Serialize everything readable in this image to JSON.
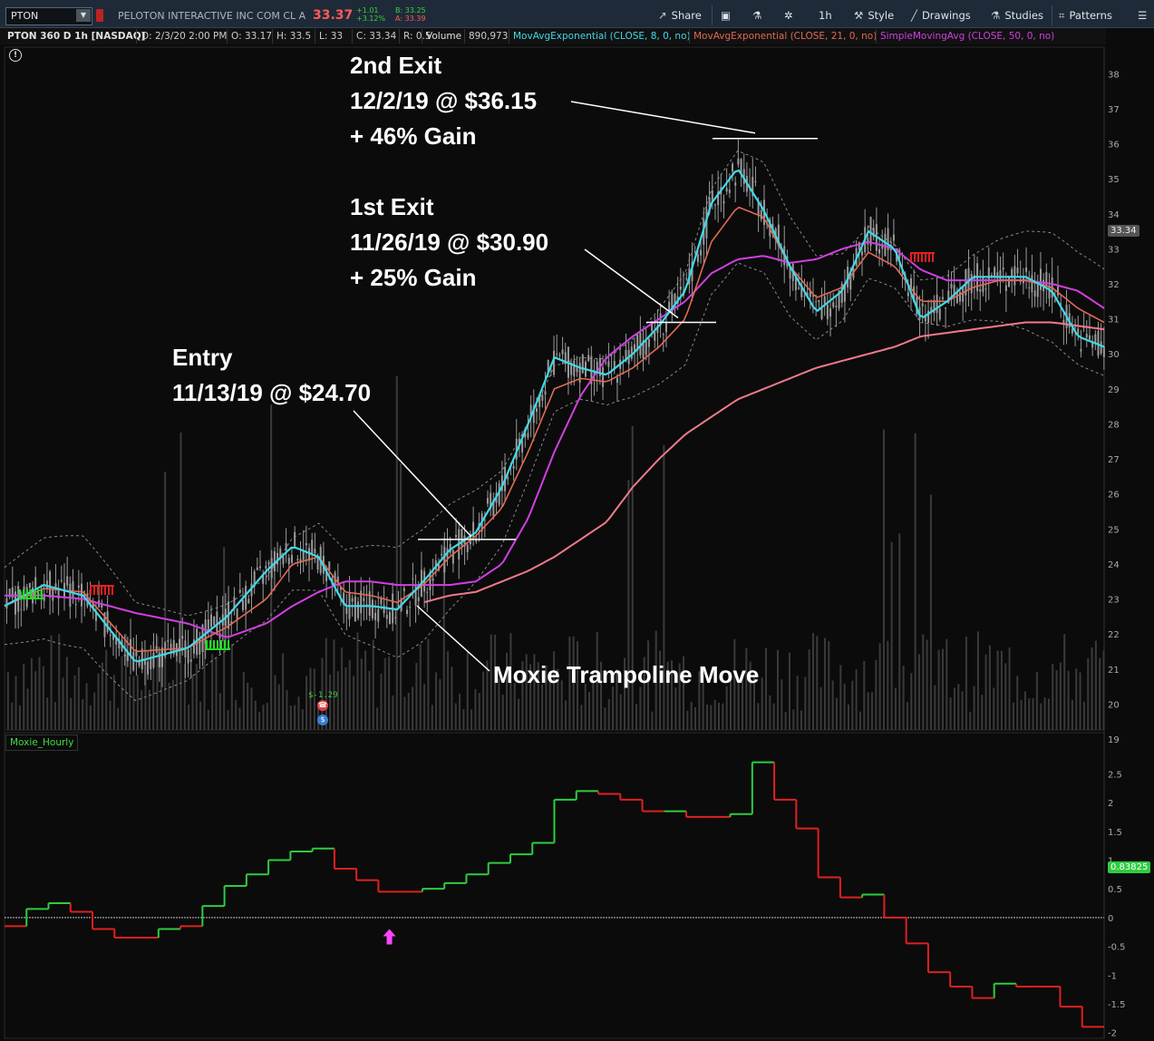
{
  "toolbar": {
    "symbol": "PTON",
    "company": "PELOTON INTERACTIVE INC COM CL A",
    "last_price": "33.37",
    "change": "+1.01",
    "change_pct": "+3.12%",
    "bid": "B: 33.25",
    "ask": "A: 33.39",
    "share_label": "Share",
    "interval_label": "1h",
    "style_label": "Style",
    "drawings_label": "Drawings",
    "studies_label": "Studies",
    "patterns_label": "Patterns"
  },
  "infobar": {
    "title": "PTON 360 D 1h [NASDAQ]",
    "date": "D: 2/3/20 2:00 PM",
    "open": "O: 33.17",
    "high": "H: 33.5",
    "low": "L: 33",
    "close": "C: 33.34",
    "range": "R: 0.5",
    "volume_label": "Volume",
    "volume_value": "890,973",
    "study1": "MovAvgExponential (CLOSE, 8, 0, no)",
    "study2": "MovAvgExponential (CLOSE, 21, 0, no)",
    "study3": "SimpleMovingAvg (CLOSE, 50, 0, no)"
  },
  "colors": {
    "ema8": "#40d8e8",
    "ema21": "#e06a55",
    "sma50": "#d040e0",
    "sma200": "#f07a8a",
    "up": "#2ecc40",
    "down": "#e02020",
    "candle": "#9a9a9a",
    "volume": "#3a3a3a"
  },
  "annotations": {
    "entry": [
      "Entry",
      "11/13/19 @ $24.70"
    ],
    "exit1": [
      "1st Exit",
      "11/26/19 @ $30.90",
      "+ 25% Gain"
    ],
    "exit2": [
      "2nd Exit",
      "12/2/19 @ $36.15",
      "+ 46% Gain"
    ],
    "trampoline": "Moxie Trampoline Move"
  },
  "earnings_marker": "$-1.29",
  "lower_study": {
    "name": "Moxie_Hourly",
    "current_value": "0.83825"
  },
  "current_price_badge": "33.34",
  "chart_data": [
    {
      "type": "line",
      "title": "PTON 360 D 1h [NASDAQ]",
      "x_unit": "bar index (hourly)",
      "ylim": [
        19,
        38.5
      ],
      "yticks": [
        19,
        20,
        21,
        22,
        23,
        24,
        25,
        26,
        27,
        28,
        29,
        30,
        31,
        32,
        33,
        34,
        35,
        36,
        37,
        38
      ],
      "grid": false,
      "x": [
        0,
        30,
        60,
        100,
        140,
        170,
        200,
        220,
        240,
        260,
        280,
        300,
        320,
        340,
        360,
        380,
        400,
        420,
        440,
        460,
        480,
        500,
        520,
        540,
        560,
        580,
        600,
        620,
        640,
        660,
        680,
        700,
        720,
        740,
        760,
        780,
        800,
        820,
        840
      ],
      "series": [
        {
          "name": "MovAvgExponential (CLOSE, 8, 0, no)",
          "values": [
            22.8,
            23.4,
            23.1,
            21.2,
            21.6,
            22.5,
            23.8,
            24.5,
            24.2,
            22.8,
            22.8,
            22.7,
            23.5,
            24.4,
            24.9,
            26.2,
            28.0,
            29.9,
            29.6,
            29.4,
            30.0,
            30.8,
            31.8,
            34.3,
            35.3,
            34.1,
            32.5,
            31.2,
            31.8,
            33.5,
            33.0,
            31.0,
            31.5,
            32.2,
            32.2,
            32.2,
            31.8,
            30.5,
            30.2
          ]
        },
        {
          "name": "MovAvgExponential (CLOSE, 21, 0, no)",
          "values": [
            22.8,
            23.3,
            23.2,
            21.5,
            21.6,
            22.2,
            23.0,
            24.0,
            24.2,
            23.2,
            23.1,
            22.9,
            23.4,
            24.2,
            24.8,
            25.6,
            27.2,
            29.0,
            29.3,
            29.2,
            29.6,
            30.2,
            31.0,
            33.2,
            34.2,
            33.9,
            32.5,
            31.6,
            31.9,
            32.9,
            32.5,
            31.5,
            31.5,
            31.9,
            32.1,
            32.1,
            31.9,
            31.3,
            30.9
          ]
        },
        {
          "name": "SimpleMovingAvg (CLOSE, 50, 0, no)",
          "values": [
            23.1,
            23.1,
            23.0,
            22.6,
            22.3,
            21.9,
            22.3,
            22.8,
            23.2,
            23.5,
            23.5,
            23.4,
            23.4,
            23.4,
            23.5,
            24.0,
            25.3,
            27.2,
            28.8,
            29.9,
            30.5,
            31.0,
            31.5,
            32.3,
            32.7,
            32.8,
            32.6,
            32.7,
            33.0,
            33.2,
            33.0,
            32.4,
            32.1,
            32.1,
            32.1,
            32.1,
            32.0,
            31.8,
            31.3
          ]
        },
        {
          "name": "SimpleMovingAvg (CLOSE, 200)",
          "values": [
            null,
            null,
            null,
            null,
            null,
            null,
            null,
            null,
            null,
            null,
            null,
            null,
            22.9,
            23.1,
            23.2,
            23.5,
            23.8,
            24.2,
            24.7,
            25.2,
            26.2,
            27.0,
            27.7,
            28.2,
            28.7,
            29.0,
            29.3,
            29.6,
            29.8,
            30.0,
            30.2,
            30.5,
            30.6,
            30.7,
            30.8,
            30.9,
            30.9,
            30.8,
            30.7
          ]
        }
      ],
      "ema8_high": [
        null,
        null,
        null,
        null,
        null,
        null,
        null,
        null,
        null,
        null,
        null,
        null,
        null,
        null,
        null,
        null,
        null,
        null,
        null,
        null,
        null,
        null,
        null,
        null,
        null,
        null,
        null,
        null,
        null,
        null,
        null,
        null,
        null,
        null,
        null,
        null,
        null,
        null,
        null
      ]
    },
    {
      "type": "line",
      "title": "Moxie_Hourly",
      "ylim": [
        -2.1,
        2.9
      ],
      "yticks": [
        -2,
        -1.5,
        -1,
        -0.5,
        0,
        0.5,
        1,
        1.5,
        2,
        2.5
      ],
      "zero_line": 0,
      "step_values": [
        -0.15,
        0.15,
        0.25,
        0.1,
        -0.2,
        -0.35,
        -0.35,
        -0.2,
        -0.15,
        0.2,
        0.55,
        0.75,
        1.0,
        1.15,
        1.2,
        0.85,
        0.65,
        0.45,
        0.45,
        0.5,
        0.6,
        0.75,
        0.95,
        1.1,
        1.3,
        2.05,
        2.2,
        2.15,
        2.05,
        1.85,
        1.85,
        1.75,
        1.75,
        1.8,
        2.7,
        2.05,
        1.55,
        0.7,
        0.35,
        0.4,
        0.0,
        -0.45,
        -0.95,
        -1.2,
        -1.4,
        -1.15,
        -1.2,
        -1.2,
        -1.55,
        -1.9
      ],
      "step_colors": [
        "r",
        "g",
        "g",
        "r",
        "r",
        "r",
        "r",
        "g",
        "r",
        "g",
        "g",
        "g",
        "g",
        "g",
        "g",
        "r",
        "r",
        "r",
        "r",
        "g",
        "g",
        "g",
        "g",
        "g",
        "g",
        "g",
        "g",
        "r",
        "r",
        "r",
        "g",
        "r",
        "r",
        "g",
        "g",
        "r",
        "r",
        "r",
        "r",
        "g",
        "r",
        "r",
        "r",
        "r",
        "r",
        "g",
        "r",
        "r",
        "r",
        "r"
      ],
      "up_arrow_at_step": 17
    }
  ]
}
